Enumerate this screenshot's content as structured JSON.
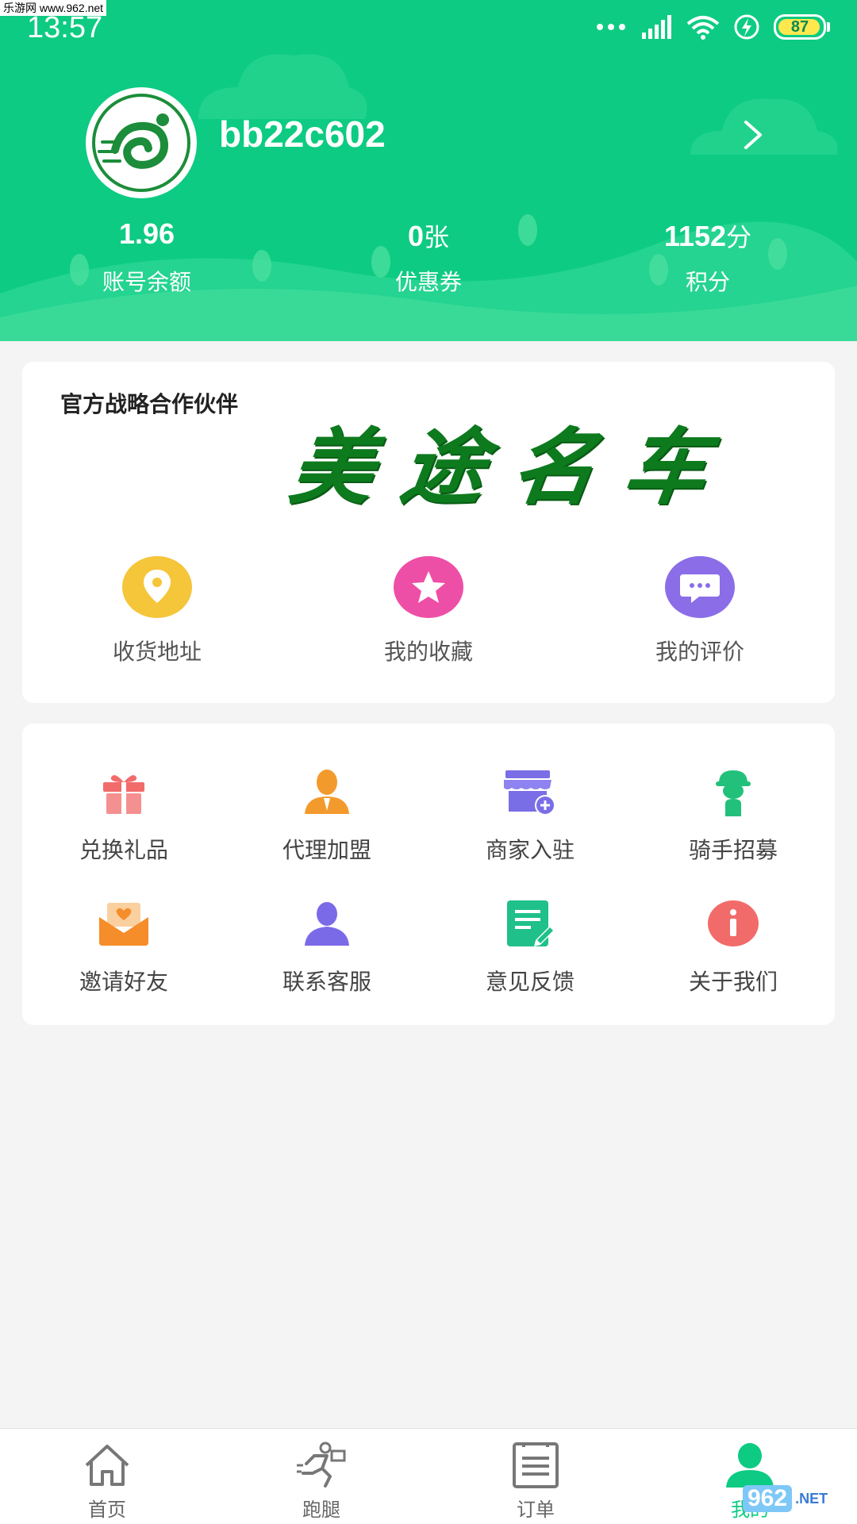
{
  "watermark": "乐游网 www.962.net",
  "status_bar": {
    "time": "13:57",
    "battery": "87"
  },
  "profile": {
    "username": "bb22c602"
  },
  "stats": [
    {
      "value": "1.96",
      "unit": "",
      "label": "账号余额"
    },
    {
      "value": "0",
      "unit": "张",
      "label": "优惠券"
    },
    {
      "value": "1152",
      "unit": "分",
      "label": "积分"
    }
  ],
  "partner": {
    "title": "官方战略合作伙伴",
    "brand_chars": [
      "美",
      "途",
      "名",
      "车"
    ]
  },
  "quick_links": [
    {
      "label": "收货地址",
      "icon": "location-pin-icon",
      "color": "#f5c53a"
    },
    {
      "label": "我的收藏",
      "icon": "star-icon",
      "color": "#ee4fa6"
    },
    {
      "label": "我的评价",
      "icon": "chat-bubble-icon",
      "color": "#8b6de8"
    }
  ],
  "services": [
    {
      "label": "兑换礼品",
      "icon": "gift-icon",
      "color": "#f26b6b"
    },
    {
      "label": "代理加盟",
      "icon": "agent-icon",
      "color": "#f39a2c"
    },
    {
      "label": "商家入驻",
      "icon": "store-icon",
      "color": "#7a6ee6"
    },
    {
      "label": "骑手招募",
      "icon": "rider-icon",
      "color": "#22c17b"
    },
    {
      "label": "邀请好友",
      "icon": "invite-envelope-icon",
      "color": "#f58d2a"
    },
    {
      "label": "联系客服",
      "icon": "customer-service-icon",
      "color": "#7b6ae8"
    },
    {
      "label": "意见反馈",
      "icon": "feedback-icon",
      "color": "#1fc08a"
    },
    {
      "label": "关于我们",
      "icon": "info-icon",
      "color": "#f26b6b"
    }
  ],
  "tabbar": [
    {
      "label": "首页",
      "icon": "home-icon"
    },
    {
      "label": "跑腿",
      "icon": "runner-icon"
    },
    {
      "label": "订单",
      "icon": "order-list-icon"
    },
    {
      "label": "我的",
      "icon": "user-icon"
    }
  ],
  "logo": {
    "number": "962",
    "suffix": ".NET",
    "sub": "乐游网"
  },
  "colors": {
    "brand_green": "#0dcb82",
    "page_bg": "#f4f4f4",
    "brand_calligraphy": "#0d7a1e"
  }
}
